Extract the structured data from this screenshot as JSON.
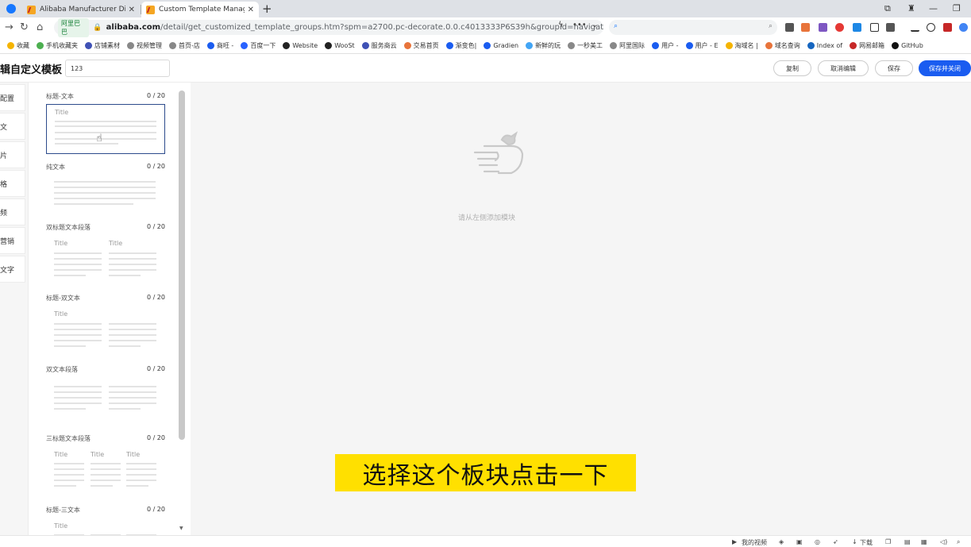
{
  "browser": {
    "tabs": [
      {
        "title": "Alibaba Manufacturer Direc"
      },
      {
        "title": "Custom Template Manager"
      }
    ],
    "url": {
      "site_badge": "阿里巴巴",
      "host": "alibaba.com",
      "path": "/detail/get_customized_template_groups.htm?spm=a2700.pc-decorate.0.0.c4013333P6S39h&groupId=navigator"
    },
    "bookmarks": [
      "收藏",
      "手机收藏夹",
      "店铺素材",
      "视频管理",
      "首页-店",
      "商旺 -",
      "百度一下",
      "Website",
      "WooSt",
      "服务商云",
      "交易首页",
      "渐变色|",
      "Gradien",
      "新鲜的玩",
      "一秒美工",
      "阿里国际",
      "用户 - ",
      "用户 - E",
      "淘域名 |",
      "域名查询",
      "Index of",
      "网易邮箱",
      "GitHub"
    ]
  },
  "header": {
    "title": "辑自定义模板",
    "template_name": "123",
    "btn_copy": "复制",
    "btn_cancel": "取消编辑",
    "btn_save": "保存",
    "btn_save_close": "保存并关闭"
  },
  "leftnav": [
    "配置",
    "文",
    "片",
    "格",
    "频",
    "营销",
    "文字"
  ],
  "modules": [
    {
      "label": "标题-文本",
      "count": "0 / 20",
      "titles": [
        "Title"
      ]
    },
    {
      "label": "纯文本",
      "count": "0 / 20",
      "titles": []
    },
    {
      "label": "双标题文本段落",
      "count": "0 / 20",
      "titles": [
        "Title",
        "Title"
      ]
    },
    {
      "label": "标题-双文本",
      "count": "0 / 20",
      "titles": [
        "Title"
      ]
    },
    {
      "label": "双文本段落",
      "count": "0 / 20",
      "titles": []
    },
    {
      "label": "三标题文本段落",
      "count": "0 / 20",
      "titles": [
        "Title",
        "Title",
        "Title"
      ]
    },
    {
      "label": "标题-三文本",
      "count": "0 / 20",
      "titles": [
        "Title"
      ]
    }
  ],
  "canvas": {
    "empty_hint": "请从左侧添加模块"
  },
  "subtitle": "选择这个板块点击一下",
  "statusbar": {
    "video_label": "我的视频",
    "download_label": "下载"
  },
  "colors": {
    "primary": "#1a5cf0",
    "selected_border": "#2d4b8c",
    "subtitle_bg": "#ffe000"
  }
}
